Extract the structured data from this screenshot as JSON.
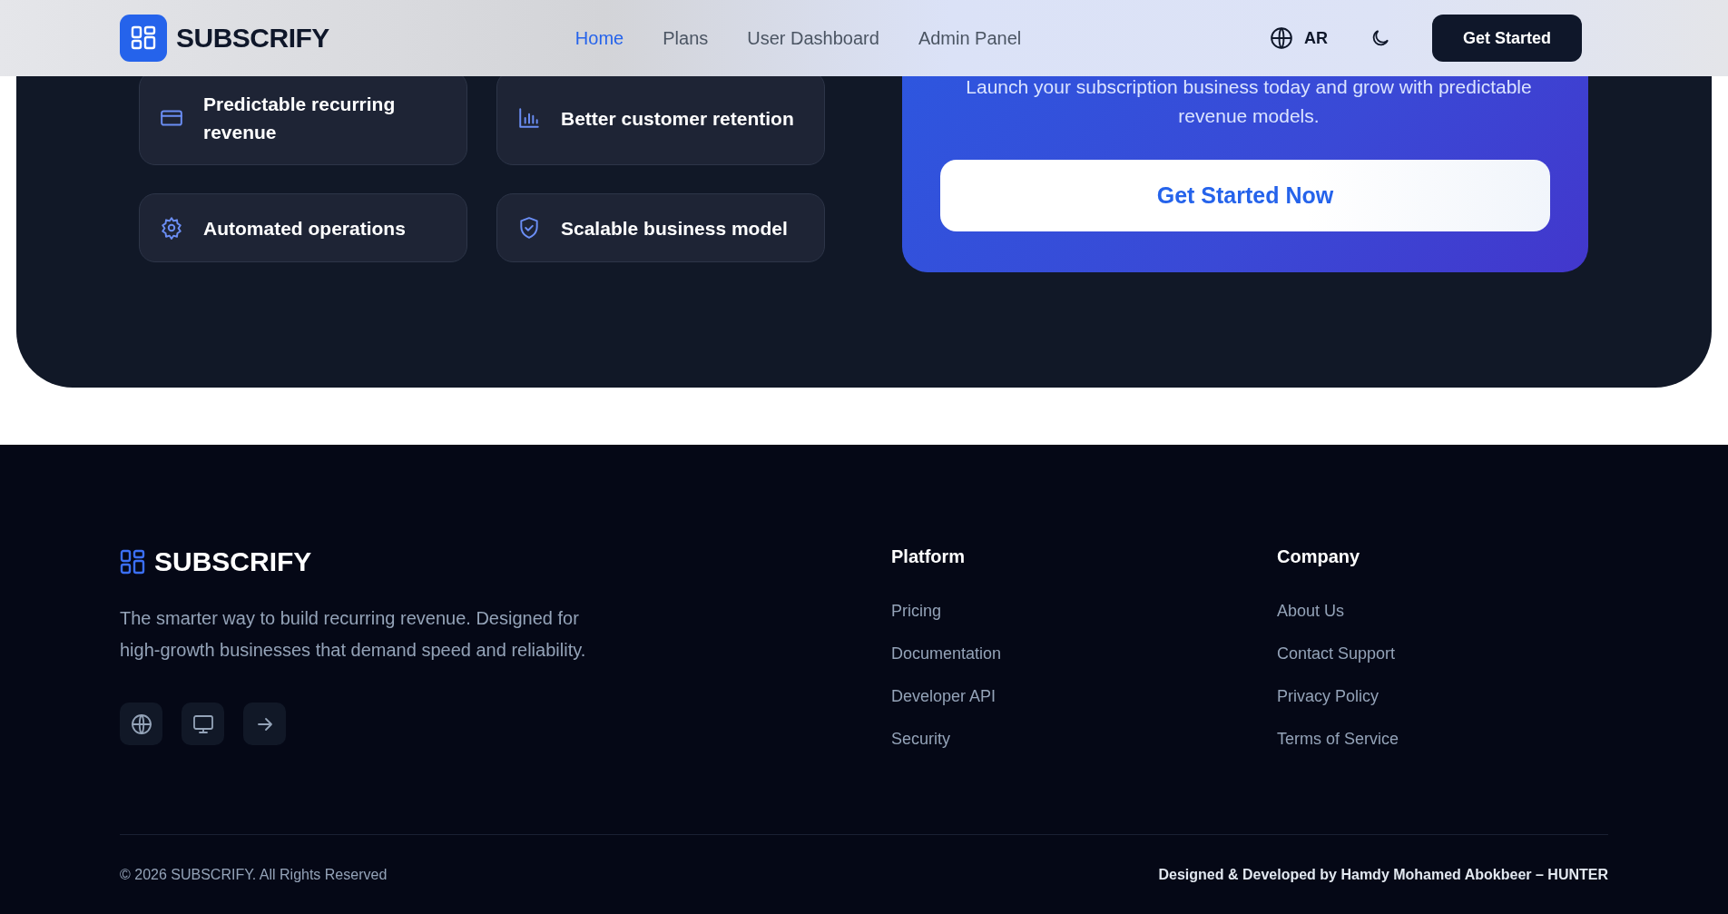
{
  "header": {
    "brand": "SUBSCRIFY",
    "nav": [
      {
        "label": "Home",
        "selected": true
      },
      {
        "label": "Plans",
        "selected": false
      },
      {
        "label": "User Dashboard",
        "selected": false
      },
      {
        "label": "Admin Panel",
        "selected": false
      }
    ],
    "language": "AR",
    "cta": "Get Started"
  },
  "features": [
    {
      "kind": "card",
      "label": "Predictable recurring revenue"
    },
    {
      "kind": "chart",
      "label": "Better customer retention"
    },
    {
      "kind": "gear",
      "label": "Automated operations"
    },
    {
      "kind": "shield",
      "label": "Scalable business model"
    }
  ],
  "cta_card": {
    "text": "Launch your subscription business today and grow with predictable revenue models.",
    "button": "Get Started Now"
  },
  "footer": {
    "brand": "SUBSCRIFY",
    "description": "The smarter way to build recurring revenue. Designed for high-growth businesses that demand speed and reliability.",
    "social": [
      {
        "kind": "globe"
      },
      {
        "kind": "monitor"
      },
      {
        "kind": "arrow"
      }
    ],
    "columns": [
      {
        "title": "Platform",
        "links": [
          "Pricing",
          "Documentation",
          "Developer API",
          "Security"
        ]
      },
      {
        "title": "Company",
        "links": [
          "About Us",
          "Contact Support",
          "Privacy Policy",
          "Terms of Service"
        ]
      }
    ],
    "copyright": "© 2026 SUBSCRIFY. All Rights Reserved",
    "credit": "Designed & Developed by Hamdy Mohamed Abokbeer – HUNTER"
  }
}
